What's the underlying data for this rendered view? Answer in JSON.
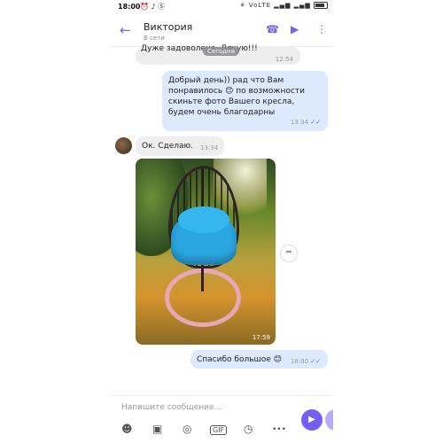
{
  "status_bar": {
    "time": "18:00",
    "left_icons": "⏰ ♪ Ⓢ",
    "right_icons": "✳ VoLTE ▂▄▆ ▂▄▆"
  },
  "header": {
    "back_icon": "←",
    "contact_name": "Виктория",
    "contact_status": "В сети",
    "call_icon": "☎",
    "video_icon": "▶",
    "menu_icon": "⋮"
  },
  "messages": {
    "m0": {
      "text": "Дуже задоволена. Дякую!!!",
      "time": "12:54"
    },
    "date_pill": "Сегодня",
    "m1": {
      "text": "Добрый день)) рад что Вам понравилось 😊 по возможности скиньте фото Вашего кресла, будем очень благодарны",
      "time": "13:34",
      "ticks": "✓✓"
    },
    "m2": {
      "text": "Ок. Сделаю.",
      "time": "13:34"
    },
    "photo": {
      "time": "17:59"
    },
    "m3": {
      "text": "Спасибо большое 😊",
      "time": "18:00",
      "ticks": "✓✓"
    }
  },
  "share_icon": "➦",
  "composer": {
    "placeholder": "Напишите сообщение...",
    "send_icon": "▶",
    "toolbar": {
      "sticker": "☻",
      "gallery": "▣",
      "camera": "◎",
      "gif": "GIF",
      "timer": "◷",
      "more": "•••"
    }
  },
  "colors": {
    "accent": "#7360f2",
    "outgoing_bubble": "#dce9ff",
    "incoming_bubble": "#eeeeee"
  }
}
